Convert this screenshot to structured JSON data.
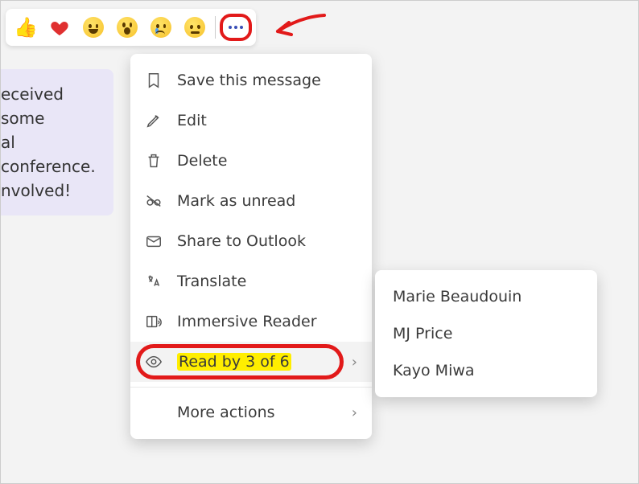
{
  "message": {
    "line1": "eceived some",
    "line2": "al conference.",
    "line3": "nvolved!"
  },
  "menu": {
    "save": "Save this message",
    "edit": "Edit",
    "delete": "Delete",
    "markUnread": "Mark as unread",
    "shareOutlook": "Share to Outlook",
    "translate": "Translate",
    "immersive": "Immersive Reader",
    "readBy": "Read by 3 of 6",
    "moreActions": "More actions"
  },
  "readers": [
    "Marie Beaudouin",
    "MJ Price",
    "Kayo Miwa"
  ]
}
